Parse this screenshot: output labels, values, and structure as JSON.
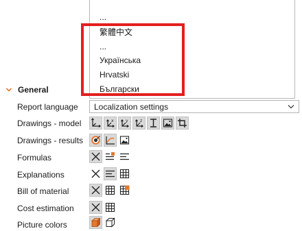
{
  "language_dropdown": {
    "items": [
      "...",
      "繁體中文",
      "...",
      "Українська",
      "Hrvatski",
      "Български"
    ]
  },
  "group": {
    "title": "General"
  },
  "rows": {
    "report_language": {
      "label": "Report language",
      "value": "Localization settings"
    },
    "drawings_model": {
      "label": "Drawings - model"
    },
    "drawings_results": {
      "label": "Drawings - results"
    },
    "formulas": {
      "label": "Formulas"
    },
    "explanations": {
      "label": "Explanations"
    },
    "bill_of_material": {
      "label": "Bill of material"
    },
    "cost_estimation": {
      "label": "Cost estimation"
    },
    "picture_colors": {
      "label": "Picture colors"
    }
  },
  "colors": {
    "highlight": "#e41e1e",
    "accent": "#e8782a",
    "toggle_on": "#d9d9d9"
  }
}
